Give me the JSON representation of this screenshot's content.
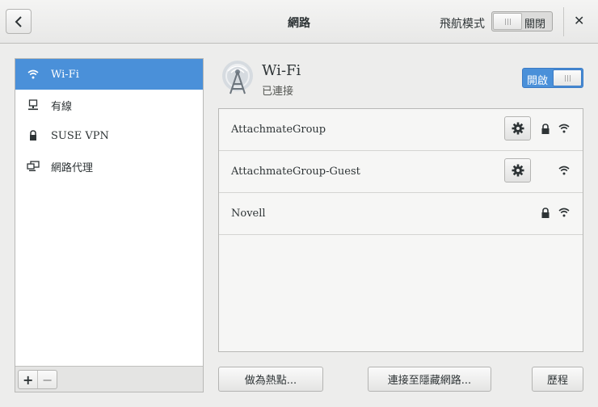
{
  "header": {
    "title": "網路",
    "airplane_label": "飛航模式",
    "airplane_state": "關閉"
  },
  "sidebar": {
    "items": [
      {
        "label": "Wi-Fi",
        "icon": "wifi-icon"
      },
      {
        "label": "有線",
        "icon": "wired-icon"
      },
      {
        "label": "SUSE VPN",
        "icon": "vpn-lock-icon"
      },
      {
        "label": "網路代理",
        "icon": "proxy-icon"
      }
    ],
    "add": "+",
    "remove": "−"
  },
  "wifi": {
    "title": "Wi-Fi",
    "status": "已連接",
    "switch_state": "開啟"
  },
  "networks": [
    {
      "name": "AttachmateGroup",
      "settings": true,
      "secured": true
    },
    {
      "name": "AttachmateGroup-Guest",
      "settings": true,
      "secured": false
    },
    {
      "name": "Novell",
      "settings": false,
      "secured": true
    }
  ],
  "buttons": {
    "hotspot": "做為熱點...",
    "hidden": "連接至隱藏網路...",
    "history": "歷程"
  },
  "colors": {
    "accent": "#4a90d9"
  }
}
